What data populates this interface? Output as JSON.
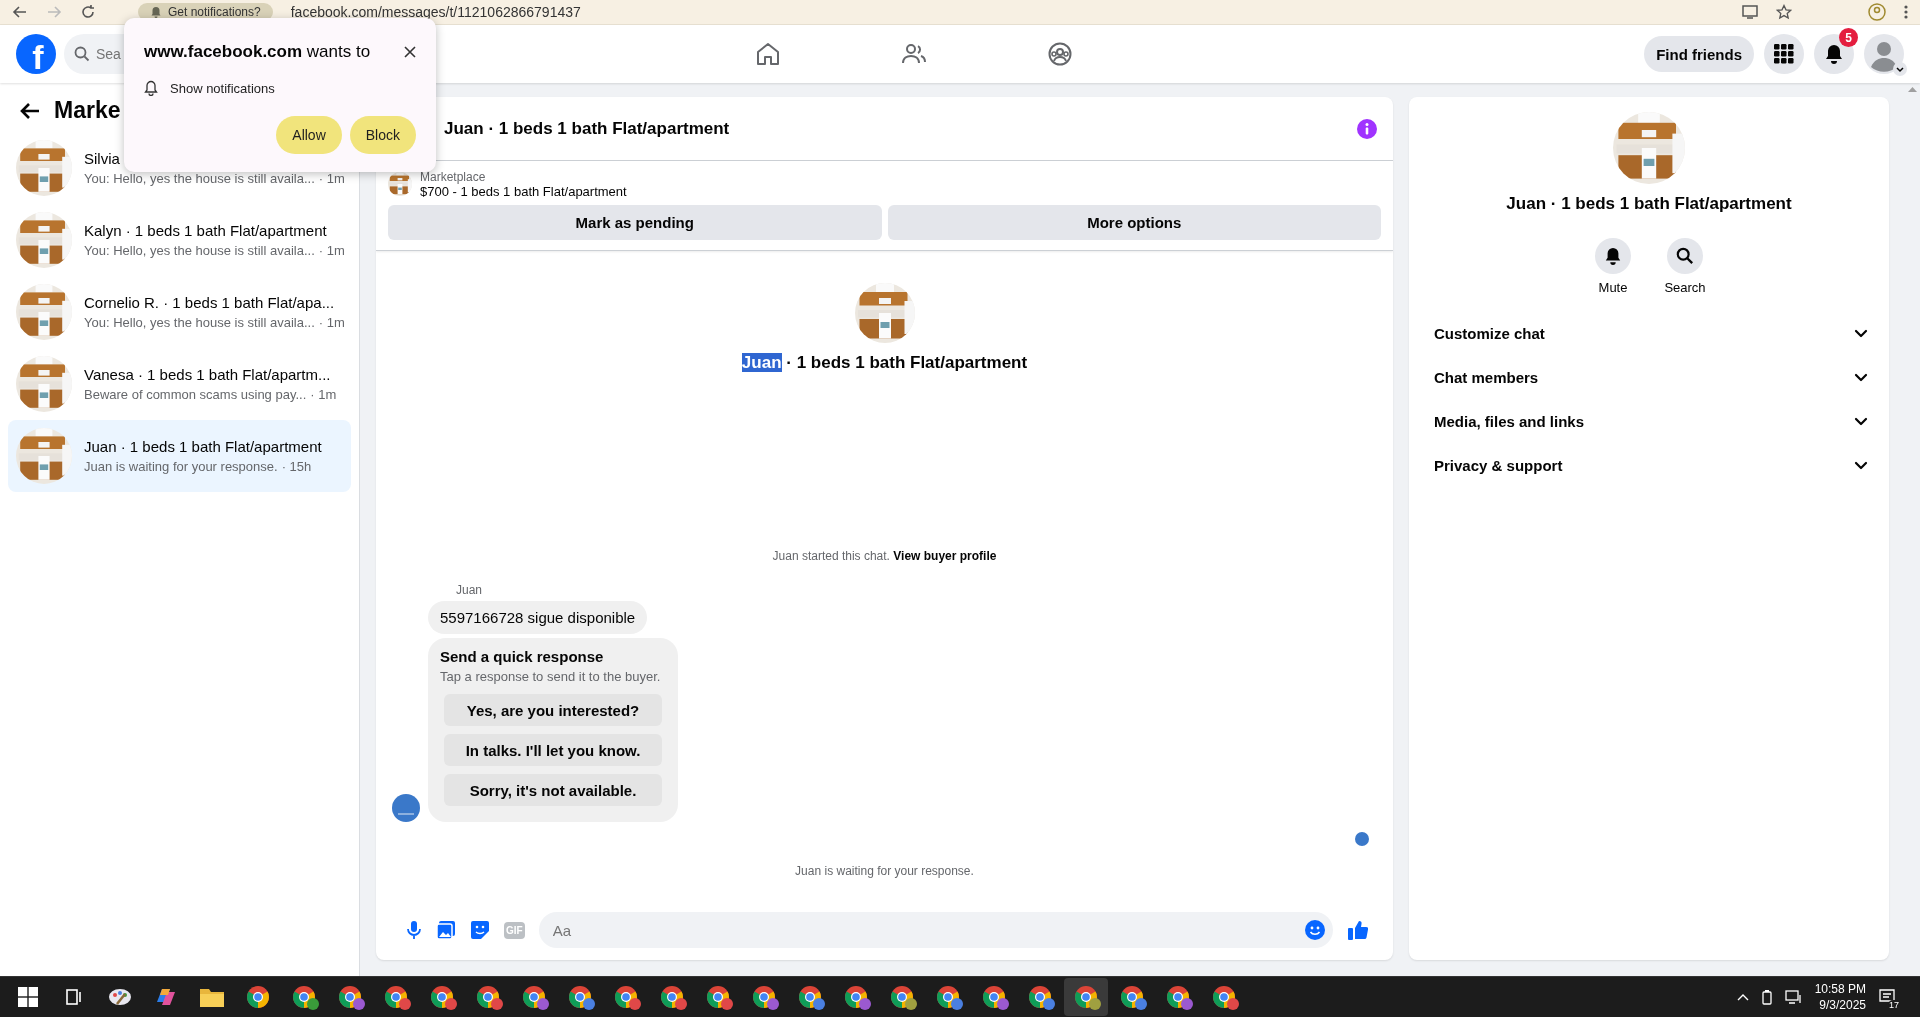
{
  "browser": {
    "chip": "Get notifications?",
    "url": "facebook.com/messages/t/1121062866791437"
  },
  "header": {
    "logo": "f",
    "search_placeholder": "Sea",
    "find_friends": "Find friends",
    "notification_count": "5"
  },
  "popup": {
    "title": "**www.facebook.com** wants to",
    "permission": "Show notifications",
    "buttons": [
      "Allow",
      "Block"
    ]
  },
  "sidebar": {
    "title": "Marke",
    "conversations": [
      {
        "title": "Silvia",
        "preview": "You: Hello, yes the house is still availa...",
        "time": "· 1m",
        "selected": false
      },
      {
        "title": "Kalyn · 1 beds 1 bath Flat/apartment",
        "preview": "You: Hello, yes the house is still availa...",
        "time": "· 1m",
        "selected": false
      },
      {
        "title": "Cornelio R. · 1 beds 1 bath Flat/apa...",
        "preview": "You: Hello, yes the house is still availa...",
        "time": "· 1m",
        "selected": false
      },
      {
        "title": "Vanesa · 1 beds 1 bath Flat/apartm...",
        "preview": "Beware of common scams using pay...",
        "time": "· 1m",
        "selected": false
      },
      {
        "title": "Juan · 1 beds 1 bath Flat/apartment",
        "preview": "Juan is waiting for your response.",
        "time": "· 15h",
        "selected": true
      }
    ]
  },
  "chat": {
    "title": "Juan · 1 beds 1 bath Flat/apartment",
    "listing": {
      "label": "Marketplace",
      "text": "$700 - 1 beds 1 bath Flat/apartment",
      "actions": [
        "Mark as pending",
        "More options"
      ]
    },
    "intro": {
      "name": "Juan",
      "name_highlighted": true,
      "rest": "· 1 beds 1 bath Flat/apartment"
    },
    "started": {
      "text": "Juan started this chat.",
      "link": "View buyer profile"
    },
    "sender": "Juan",
    "message": "5597166728 sigue disponible",
    "quick": {
      "title": "Send a quick response",
      "subtitle": "Tap a response to send it to the buyer.",
      "options": [
        "Yes, are you interested?",
        "In talks. I'll let you know.",
        "Sorry, it's not available."
      ]
    },
    "status": "Juan is waiting for your response.",
    "composer": {
      "gif": "GIF",
      "placeholder": "Aa"
    }
  },
  "details": {
    "title": "Juan · 1 beds 1 bath Flat/apartment",
    "actions": [
      {
        "kind": "mute",
        "label": "Mute"
      },
      {
        "kind": "search",
        "label": "Search"
      }
    ],
    "sections": [
      {
        "label": "Customize chat",
        "expanded": false
      },
      {
        "label": "Chat members",
        "expanded": false
      },
      {
        "label": "Media, files and links",
        "expanded": false
      },
      {
        "label": "Privacy & support",
        "expanded": false
      }
    ]
  },
  "taskbar": {
    "apps": [
      {
        "kind": "start",
        "selected": false
      },
      {
        "kind": "task-view",
        "selected": false
      },
      {
        "kind": "paint",
        "selected": false
      },
      {
        "kind": "copilot",
        "selected": false
      },
      {
        "kind": "folder",
        "selected": false
      },
      {
        "kind": "chrome",
        "selected": false
      },
      {
        "kind": "chrome-profile",
        "color": "#3a9b3a",
        "selected": false
      },
      {
        "kind": "chrome-profile",
        "color": "#9b59d0",
        "selected": false
      },
      {
        "kind": "chrome-profile",
        "color": "#e04848",
        "selected": false
      },
      {
        "kind": "chrome-profile",
        "color": "#e04848",
        "selected": false
      },
      {
        "kind": "chrome-profile",
        "color": "#e04848",
        "selected": false
      },
      {
        "kind": "chrome-profile",
        "color": "#9b59d0",
        "selected": false
      },
      {
        "kind": "chrome-profile",
        "color": "#4a7fe0",
        "selected": false
      },
      {
        "kind": "chrome-profile",
        "color": "#e04848",
        "selected": false
      },
      {
        "kind": "chrome-profile",
        "color": "#e04848",
        "selected": false
      },
      {
        "kind": "chrome-profile",
        "color": "#e04848",
        "selected": false
      },
      {
        "kind": "chrome-profile",
        "color": "#9b59d0",
        "selected": false
      },
      {
        "kind": "chrome-profile",
        "color": "#4a7fe0",
        "selected": false
      },
      {
        "kind": "chrome-profile",
        "color": "#9b59d0",
        "selected": false
      },
      {
        "kind": "chrome-profile",
        "color": "#a0a040",
        "selected": false
      },
      {
        "kind": "chrome-profile",
        "color": "#4a7fe0",
        "selected": false
      },
      {
        "kind": "chrome-profile",
        "color": "#9b59d0",
        "selected": false
      },
      {
        "kind": "chrome-profile",
        "color": "#4a7fe0",
        "selected": false
      },
      {
        "kind": "chrome-profile",
        "color": "#a0a040",
        "selected": true
      },
      {
        "kind": "chrome-profile",
        "color": "#4a7fe0",
        "selected": false
      },
      {
        "kind": "chrome-profile",
        "color": "#9b59d0",
        "selected": false
      },
      {
        "kind": "chrome-profile",
        "color": "#e04848",
        "selected": false
      }
    ],
    "time": "10:58 PM",
    "date": "9/3/2025",
    "notifications": "17"
  }
}
